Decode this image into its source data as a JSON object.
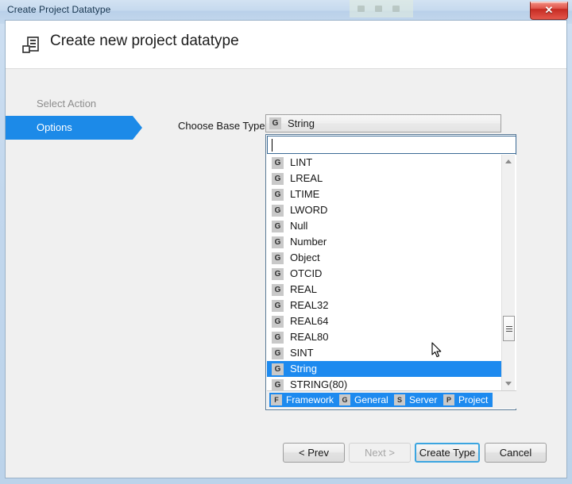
{
  "window": {
    "title": "Create Project Datatype",
    "close_label": "✕",
    "close_icon": "close-icon"
  },
  "header": {
    "icon": "datatype-icon",
    "title": "Create new project datatype"
  },
  "steps": [
    {
      "label": "Select Action",
      "state": "done"
    },
    {
      "label": "Options",
      "state": "active"
    }
  ],
  "form": {
    "base_type_label": "Choose Base Type:",
    "combo": {
      "badge": "G",
      "value": "String"
    },
    "search": {
      "value": "",
      "placeholder": ""
    }
  },
  "dropdown": {
    "items": [
      {
        "badge": "G",
        "label": "LINT",
        "selected": false
      },
      {
        "badge": "G",
        "label": "LREAL",
        "selected": false
      },
      {
        "badge": "G",
        "label": "LTIME",
        "selected": false
      },
      {
        "badge": "G",
        "label": "LWORD",
        "selected": false
      },
      {
        "badge": "G",
        "label": "Null",
        "selected": false
      },
      {
        "badge": "G",
        "label": "Number",
        "selected": false
      },
      {
        "badge": "G",
        "label": "Object",
        "selected": false
      },
      {
        "badge": "G",
        "label": "OTCID",
        "selected": false
      },
      {
        "badge": "G",
        "label": "REAL",
        "selected": false
      },
      {
        "badge": "G",
        "label": "REAL32",
        "selected": false
      },
      {
        "badge": "G",
        "label": "REAL64",
        "selected": false
      },
      {
        "badge": "G",
        "label": "REAL80",
        "selected": false
      },
      {
        "badge": "G",
        "label": "SINT",
        "selected": false
      },
      {
        "badge": "G",
        "label": "String",
        "selected": true
      },
      {
        "badge": "G",
        "label": "STRING(80)",
        "selected": false
      }
    ],
    "filters": [
      {
        "badge": "F",
        "label": "Framework"
      },
      {
        "badge": "G",
        "label": "General"
      },
      {
        "badge": "S",
        "label": "Server"
      },
      {
        "badge": "P",
        "label": "Project"
      }
    ],
    "scrollbar": {
      "up_icon": "scroll-up-arrow-icon",
      "down_icon": "scroll-down-arrow-icon"
    }
  },
  "footer": {
    "buttons": [
      {
        "label": "< Prev",
        "state": "normal"
      },
      {
        "label": "Next >",
        "state": "disabled"
      },
      {
        "label": "Create Type",
        "state": "default"
      },
      {
        "label": "Cancel",
        "state": "normal"
      }
    ]
  },
  "colors": {
    "accent": "#1d8aef",
    "titlebar": "#c4d8ed",
    "close": "#c52b22",
    "content_bg": "#f0f0f0"
  }
}
